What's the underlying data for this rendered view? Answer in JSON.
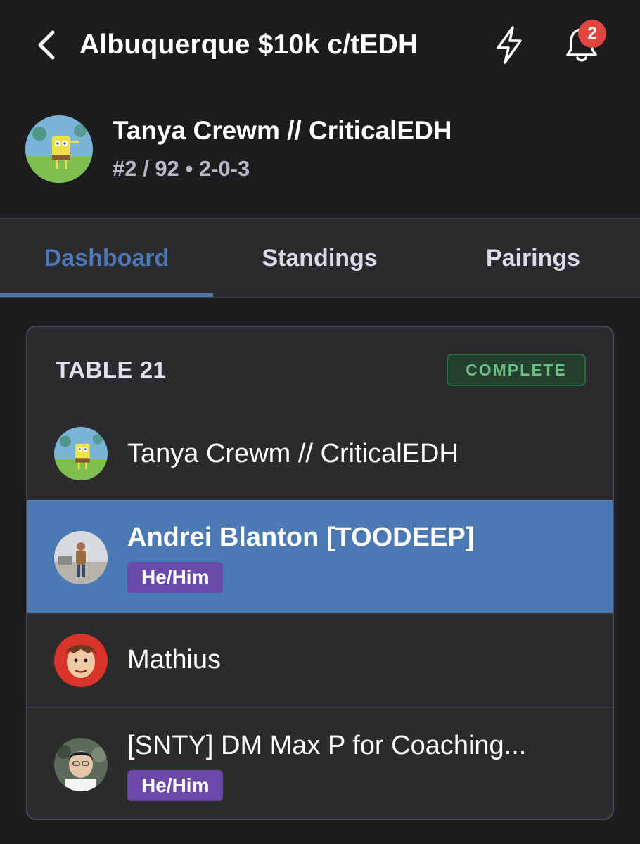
{
  "header": {
    "title": "Albuquerque $10k c/tEDH",
    "notification_count": "2"
  },
  "player": {
    "name": "Tanya Crewm // CriticalEDH",
    "rank_record": "#2 / 92 • 2-0-3"
  },
  "tabs": [
    {
      "label": "Dashboard",
      "active": true
    },
    {
      "label": "Standings",
      "active": false
    },
    {
      "label": "Pairings",
      "active": false
    }
  ],
  "table": {
    "title": "TABLE 21",
    "status": "COMPLETE",
    "players": [
      {
        "name": "Tanya Crewm // CriticalEDH",
        "pronouns": "",
        "highlighted": false
      },
      {
        "name": "Andrei Blanton [TOODEEP]",
        "pronouns": "He/Him",
        "highlighted": true
      },
      {
        "name": "Mathius",
        "pronouns": "",
        "highlighted": false
      },
      {
        "name": "[SNTY] DM Max P for Coaching...",
        "pronouns": "He/Him",
        "highlighted": false
      }
    ]
  },
  "colors": {
    "accent": "#4d77b5",
    "highlight_row": "#4b79b6",
    "badge_red": "#e0463d",
    "complete_green": "#6dbf86",
    "pronoun_purple": "#6b49a8"
  },
  "icons": {
    "back": "chevron-left-icon",
    "bolt": "lightning-bolt-icon",
    "bell": "bell-icon"
  }
}
